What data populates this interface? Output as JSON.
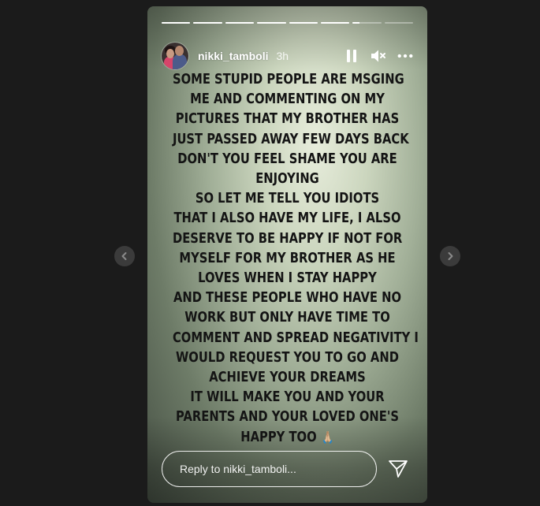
{
  "story": {
    "progress": [
      1,
      1,
      1,
      1,
      1,
      1,
      0.25,
      0
    ],
    "user": {
      "username": "nikki_tamboli",
      "time_ago": "3h"
    },
    "controls": {
      "pause_icon": "pause-icon",
      "mute_icon": "volume-muted-icon",
      "more_icon": "more-options-icon"
    },
    "text_lines": [
      "SOME STUPID PEOPLE ARE MSGING",
      "ME AND COMMENTING ON MY",
      "PICTURES THAT MY BROTHER HAS",
      "JUST PASSED AWAY FEW DAYS BACK",
      "DON'T YOU FEEL SHAME YOU ARE",
      "ENJOYING",
      "SO LET ME TELL YOU IDIOTS",
      "THAT I ALSO HAVE MY LIFE, I ALSO",
      "DESERVE TO BE HAPPY IF NOT FOR",
      "MYSELF FOR MY BROTHER AS HE",
      "LOVES WHEN I STAY HAPPY",
      "AND THESE PEOPLE WHO HAVE NO",
      "WORK BUT ONLY HAVE TIME TO",
      "COMMENT AND SPREAD NEGATIVITY I",
      "WOULD REQUEST YOU TO GO AND",
      "ACHIEVE YOUR DREAMS",
      "IT WILL MAKE YOU AND YOUR",
      "PARENTS AND YOUR LOVED ONE'S"
    ],
    "last_line": "HAPPY TOO",
    "last_line_emoji": "🙏🏼",
    "reply": {
      "placeholder": "Reply to nikki_tamboli..."
    },
    "send_icon": "send-icon"
  },
  "navigation": {
    "prev_icon": "chevron-left-icon",
    "next_icon": "chevron-right-icon"
  },
  "colors": {
    "page_background": "#1b1b1b",
    "text": "#141414",
    "nav_button": "#3b3b3b"
  }
}
